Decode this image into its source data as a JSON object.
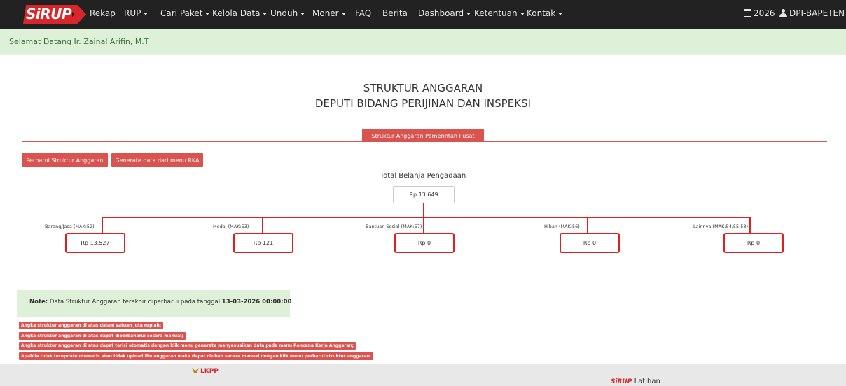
{
  "navbar": {
    "brand": "SiRUP",
    "items": [
      {
        "label": "Rekap",
        "dropdown": false
      },
      {
        "label": "RUP",
        "dropdown": true
      },
      {
        "label": "Cari Paket",
        "dropdown": true
      },
      {
        "label": "Kelola Data",
        "dropdown": true
      },
      {
        "label": "Unduh",
        "dropdown": true
      },
      {
        "label": "Moner",
        "dropdown": true
      },
      {
        "label": "FAQ",
        "dropdown": false
      },
      {
        "label": "Berita",
        "dropdown": false
      },
      {
        "label": "Dashboard",
        "dropdown": true
      },
      {
        "label": "Ketentuan",
        "dropdown": true
      },
      {
        "label": "Kontak",
        "dropdown": true
      }
    ],
    "year": "2026",
    "user": "DPI-BAPETEN",
    "icons": {
      "year": "calendar-icon",
      "user": "user-icon"
    }
  },
  "welcome": "Selamat Datang Ir. Zainal Arifin, M.T",
  "title": {
    "line1": "STRUKTUR ANGGARAN",
    "line2": "DEPUTI BIDANG PERIJINAN DAN INSPEKSI"
  },
  "tab": "Struktur Anggaran Pemerintah Pusat",
  "buttons": {
    "update": "Perbarui Struktur Anggaran",
    "generate": "Generate data dari menu RKA"
  },
  "total": {
    "label": "Total Belanja Pengadaan",
    "value": "Rp 13.649"
  },
  "categories": [
    {
      "label": "Barang/Jasa (MAK:52)",
      "value": "Rp 13.527"
    },
    {
      "label": "Modal (MAK:53)",
      "value": "Rp 121"
    },
    {
      "label": "Bantuan Sosial (MAK:57)",
      "value": "Rp 0"
    },
    {
      "label": "Hibah (MAK:56)",
      "value": "Rp 0"
    },
    {
      "label": "Lainnya (MAK:54,55,58)",
      "value": "Rp 0"
    }
  ],
  "note": {
    "prefix": "Note:",
    "text": " Data Struktur Anggaran terakhir diperbarui pada tanggal ",
    "date": "13-03-2026 00:00:00",
    "suffix": "."
  },
  "warnings": [
    "Angka struktur anggaran di atas dalam satuan juta rupiah;",
    "Angka struktur anggaran di atas dapat diperbaharui secara manual;",
    "Angka struktur anggaran di atas dapat terisi otomatis dengan klik menu generate menyesuaikan data pada menu Rencana Kerja Anggaran;",
    "Apabila tidak terupdate otomatis atau tidak upload file anggaran maka dapat diubah secara manual dengan klik menu perbarui struktur anggaran."
  ],
  "footer": {
    "lkpp": "LKPP",
    "sirup": "SiRUP",
    "sirup_suffix": "Latihan"
  },
  "colors": {
    "navbar": "#222222",
    "accent_red": "#d9534f",
    "tree_line": "#e02020",
    "welcome_bg": "#dff0d8"
  }
}
